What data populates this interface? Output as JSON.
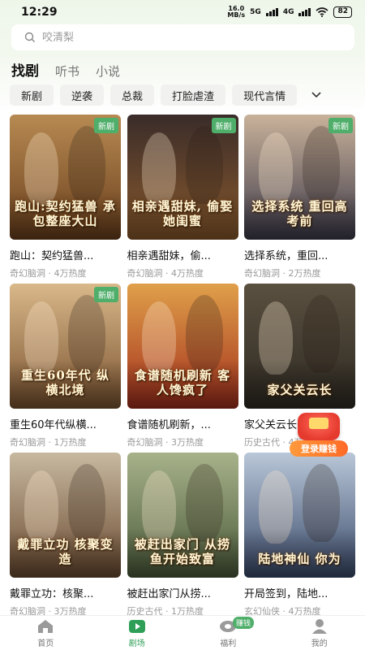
{
  "status": {
    "time": "12:29",
    "net_speed_value": "16.0",
    "net_speed_unit": "MB/s",
    "net_5g": "5G",
    "net_4g": "4G",
    "battery": "82"
  },
  "search": {
    "placeholder": "咬清梨"
  },
  "main_tabs": [
    {
      "label": "找剧",
      "active": true
    },
    {
      "label": "听书",
      "active": false
    },
    {
      "label": "小说",
      "active": false
    }
  ],
  "genres": [
    "新剧",
    "逆袭",
    "总裁",
    "打脸虐渣",
    "现代言情"
  ],
  "cards": [
    {
      "title": "跑山：契约猛兽...",
      "meta": "奇幻脑洞 · 4万热度",
      "badge": "新剧",
      "cover_text": "跑山:契约猛兽 承包整座大山",
      "color_top": "#b78a52",
      "color_bottom": "#6a3f1c"
    },
    {
      "title": "相亲遇甜妹，偷...",
      "meta": "奇幻脑洞 · 4万热度",
      "badge": "新剧",
      "cover_text": "相亲遇甜妹, 偷娶她闺蜜",
      "color_top": "#3a2c2a",
      "color_bottom": "#8a5a2c"
    },
    {
      "title": "选择系统，重回...",
      "meta": "奇幻脑洞 · 2万热度",
      "badge": "新剧",
      "cover_text": "选择系统 重回高考前",
      "color_top": "#c9b29a",
      "color_bottom": "#3d3a4a"
    },
    {
      "title": "重生60年代纵横...",
      "meta": "奇幻脑洞 · 1万热度",
      "badge": "新剧",
      "cover_text": "重生60年代 纵横北境",
      "color_top": "#d9b88a",
      "color_bottom": "#7a5330"
    },
    {
      "title": "食谱随机刷新，...",
      "meta": "奇幻脑洞 · 3万热度",
      "badge": "",
      "cover_text": "食谱随机刷新 客人馋疯了",
      "color_top": "#e0a04a",
      "color_bottom": "#a22e1c"
    },
    {
      "title": "家父关云长",
      "meta": "历史古代 · 4万热度",
      "badge": "",
      "cover_text": "家父关云长",
      "color_top": "#5a5040",
      "color_bottom": "#2e2a22"
    },
    {
      "title": "戴罪立功：核聚...",
      "meta": "奇幻脑洞 · 3万热度",
      "badge": "",
      "cover_text": "戴罪立功 核聚变造",
      "color_top": "#c7b9a0",
      "color_bottom": "#6a4a30"
    },
    {
      "title": "被赶出家门从捞...",
      "meta": "历史古代 · 1万热度",
      "badge": "",
      "cover_text": "被赶出家门 从捞鱼开始致富",
      "color_top": "#a7b28a",
      "color_bottom": "#4a5a3a"
    },
    {
      "title": "开局签到，陆地...",
      "meta": "玄幻仙侠 · 4万热度",
      "badge": "",
      "cover_text": "陆地神仙 你为",
      "color_top": "#b9c7d8",
      "color_bottom": "#3a4a6a"
    }
  ],
  "float_widget": {
    "label": "登录赚钱"
  },
  "bottom_nav": [
    {
      "label": "首页",
      "icon": "home-icon",
      "active": false
    },
    {
      "label": "剧场",
      "icon": "play-icon",
      "active": true
    },
    {
      "label": "福利",
      "icon": "coin-icon",
      "active": false,
      "badge": "赚钱"
    },
    {
      "label": "我的",
      "icon": "user-icon",
      "active": false
    }
  ],
  "colors": {
    "accent_green": "#2f9f58",
    "badge_green": "#4fae6a",
    "reward_orange": "#ff7a2a"
  }
}
